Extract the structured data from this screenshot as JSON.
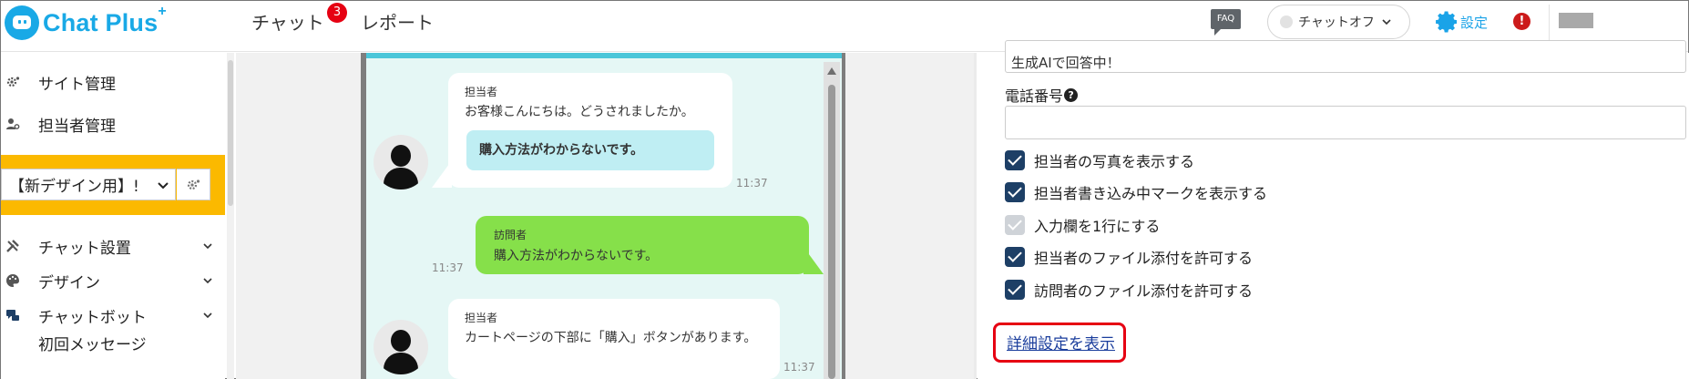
{
  "header": {
    "logo_text": "Chat Plus",
    "logo_plus": "+",
    "nav_chat": "チャット",
    "nav_chat_badge": "3",
    "nav_report": "レポート",
    "faq_label": "FAQ",
    "status_label": "チャットオフ",
    "settings_label": "設定",
    "alert_label": "!",
    "colors": {
      "brand": "#19a9e6",
      "badge": "#e60012",
      "settings": "#1aa3e8"
    }
  },
  "sidebar": {
    "items_top": [
      {
        "label": "サイト管理",
        "icon": "site-gear-icon"
      },
      {
        "label": "担当者管理",
        "icon": "users-icon"
      }
    ],
    "site_select": "【新デザイン用】!",
    "items_bottom": [
      {
        "label": "チャット設置",
        "icon": "tools-icon"
      },
      {
        "label": "デザイン",
        "icon": "palette-icon"
      },
      {
        "label": "チャットボット",
        "icon": "chat-bubbles-icon"
      }
    ],
    "sub_item": "初回メッセージ",
    "highlight_color": "#fbb900"
  },
  "chat_preview": {
    "messages": [
      {
        "sender": "担当者",
        "text": "お客様こんにちは。どうされましたか。",
        "quick_reply": "購入方法がわからないです。",
        "time": "11:37"
      },
      {
        "sender": "訪問者",
        "text": "購入方法がわからないです。",
        "time": "11:37"
      },
      {
        "sender": "担当者",
        "text": "カートページの下部に「購入」ボタンがあります。",
        "time": "11:37"
      }
    ],
    "colors": {
      "background": "#e5f7f5",
      "visitor_bubble": "#86e04a",
      "quick_reply": "#bfeef3",
      "top_bar": "#4bc6d9"
    }
  },
  "panel": {
    "top_input_value": "生成AIで回答中！",
    "phone_label": "電話番号",
    "phone_value": "",
    "checkboxes": [
      {
        "label": "担当者の写真を表示する",
        "checked": true,
        "disabled": false
      },
      {
        "label": "担当者書き込み中マークを表示する",
        "checked": true,
        "disabled": false
      },
      {
        "label": "入力欄を1行にする",
        "checked": true,
        "disabled": true
      },
      {
        "label": "担当者のファイル添付を許可する",
        "checked": true,
        "disabled": false
      },
      {
        "label": "訪問者のファイル添付を許可する",
        "checked": true,
        "disabled": false
      }
    ],
    "detail_link": "詳細設定を表示",
    "colors": {
      "checkbox": "#1d3f66",
      "link": "#1a3d9c",
      "callout": "#e60012"
    }
  }
}
